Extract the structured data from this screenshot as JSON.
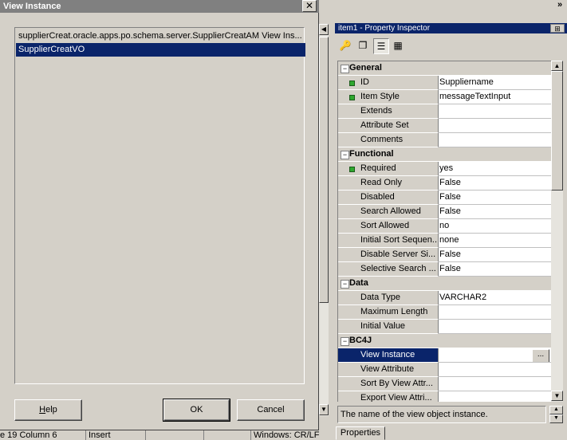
{
  "dialog": {
    "title": "View Instance",
    "close_glyph": "✕",
    "tree": [
      {
        "label": "supplierCreat.oracle.apps.po.schema.server.SupplierCreatAM View Ins...",
        "selected": false
      },
      {
        "label": "SupplierCreatVO",
        "selected": true
      }
    ],
    "buttons": {
      "help_prefix": "",
      "help_mnemonic": "H",
      "help_rest": "elp",
      "ok": "OK",
      "cancel": "Cancel"
    }
  },
  "toolbar": {
    "overflow_glyph": "»"
  },
  "inspector": {
    "title": "item1 - Property Inspector",
    "pin_glyph": "⊞",
    "tools": [
      {
        "name": "key-icon",
        "glyph": "🔑"
      },
      {
        "name": "copy-icon",
        "glyph": "❐"
      },
      {
        "name": "categorize-icon",
        "glyph": "☰"
      },
      {
        "name": "filter-icon",
        "glyph": "▦"
      }
    ],
    "rows": [
      {
        "kind": "cat",
        "name": "General"
      },
      {
        "kind": "prop",
        "name": "ID",
        "value": "Suppliername",
        "required": true
      },
      {
        "kind": "prop",
        "name": "Item Style",
        "value": "messageTextInput",
        "required": true
      },
      {
        "kind": "prop",
        "name": "Extends",
        "value": ""
      },
      {
        "kind": "prop",
        "name": "Attribute Set",
        "value": ""
      },
      {
        "kind": "prop",
        "name": "Comments",
        "value": ""
      },
      {
        "kind": "cat",
        "name": "Functional"
      },
      {
        "kind": "prop",
        "name": "Required",
        "value": "yes",
        "required": true
      },
      {
        "kind": "prop",
        "name": "Read Only",
        "value": "False"
      },
      {
        "kind": "prop",
        "name": "Disabled",
        "value": "False"
      },
      {
        "kind": "prop",
        "name": "Search Allowed",
        "value": "False"
      },
      {
        "kind": "prop",
        "name": "Sort Allowed",
        "value": "no"
      },
      {
        "kind": "prop",
        "name": "Initial Sort Sequen...",
        "value": "none"
      },
      {
        "kind": "prop",
        "name": "Disable Server Si...",
        "value": "False"
      },
      {
        "kind": "prop",
        "name": "Selective Search ...",
        "value": "False"
      },
      {
        "kind": "cat",
        "name": "Data"
      },
      {
        "kind": "prop",
        "name": "Data Type",
        "value": "VARCHAR2"
      },
      {
        "kind": "prop",
        "name": "Maximum Length",
        "value": ""
      },
      {
        "kind": "prop",
        "name": "Initial Value",
        "value": ""
      },
      {
        "kind": "cat",
        "name": "BC4J"
      },
      {
        "kind": "prop",
        "name": "View Instance",
        "value": "",
        "selected": true,
        "ellipsis": "..."
      },
      {
        "kind": "prop",
        "name": "View Attribute",
        "value": ""
      },
      {
        "kind": "prop",
        "name": "Sort By View Attr...",
        "value": ""
      },
      {
        "kind": "prop",
        "name": "Export View Attri...",
        "value": ""
      }
    ],
    "description": "The name of the view object instance.",
    "tab": "Properties"
  },
  "status": {
    "position": "e 19 Column 6",
    "mode": "Insert",
    "line_endings": "Windows: CR/LF"
  },
  "glyphs": {
    "up": "▲",
    "down": "▼",
    "left": "◀",
    "expander": "−"
  }
}
